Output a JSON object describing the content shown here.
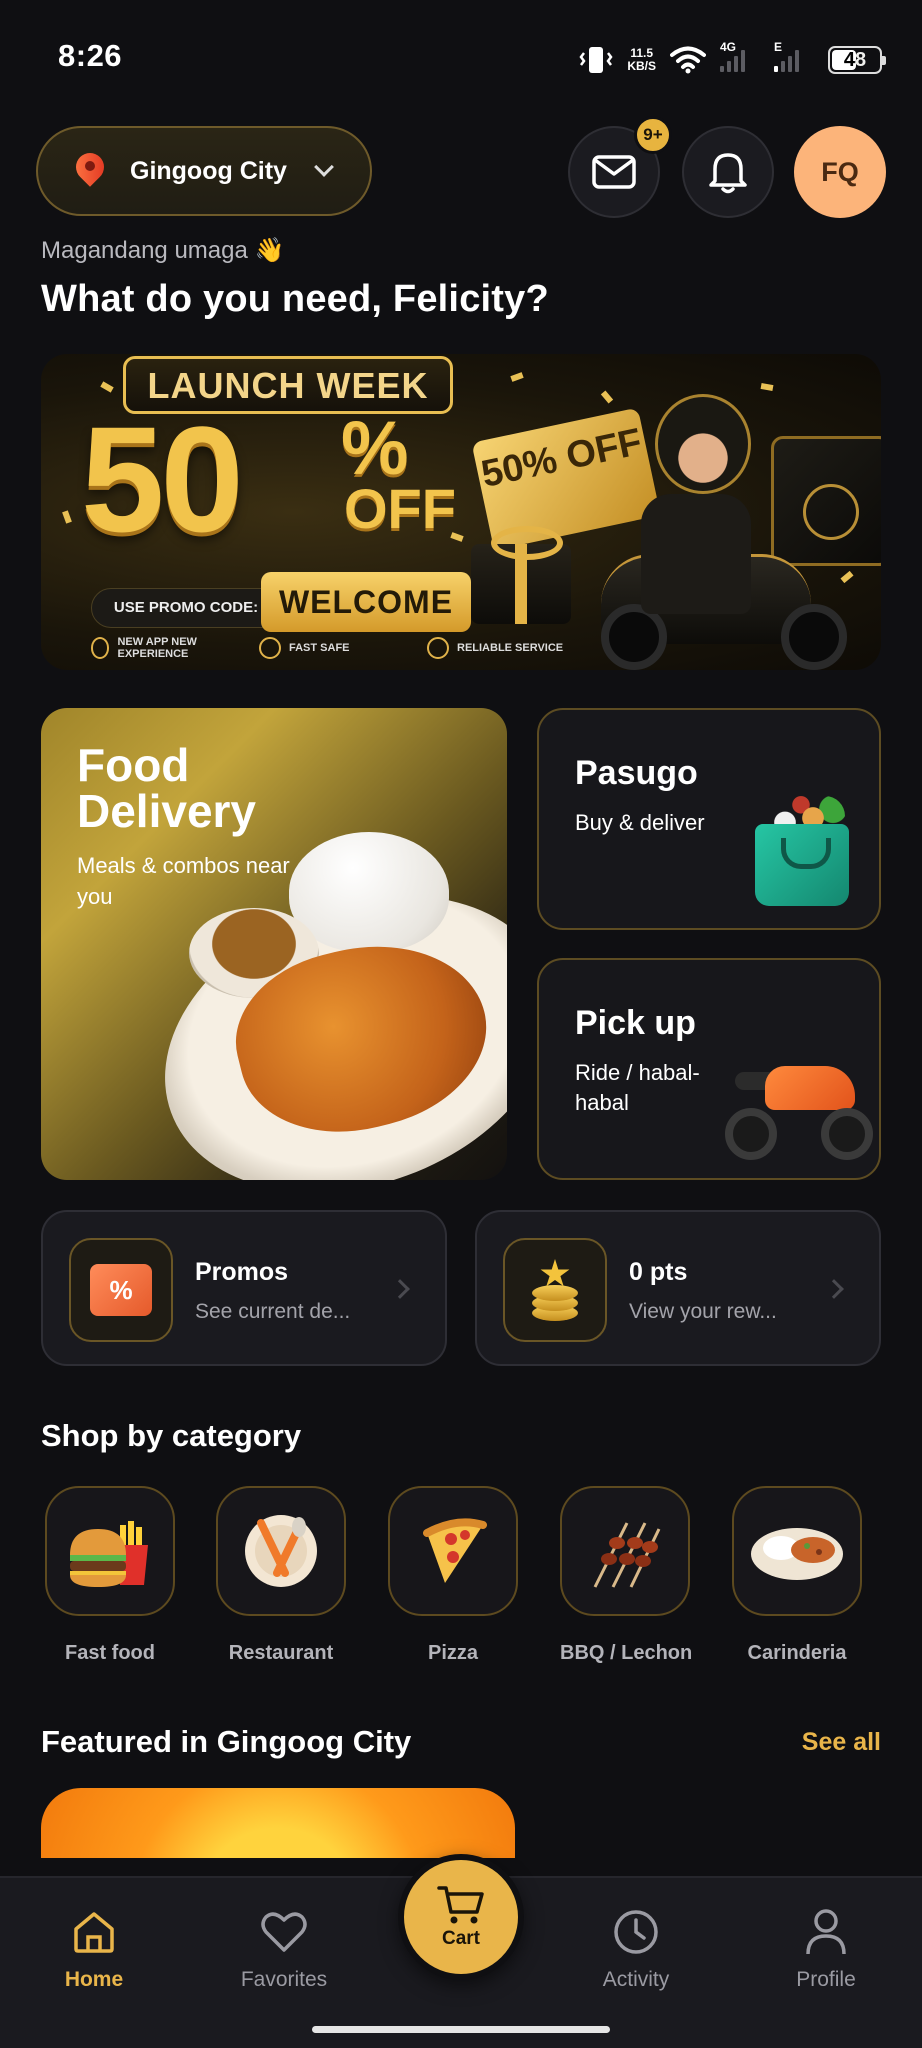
{
  "status_bar": {
    "time": "8:26",
    "net_speed_value": "11.5",
    "net_speed_unit": "KB/S",
    "network_type_1": "4G",
    "network_type_2": "E",
    "battery": "48"
  },
  "header": {
    "location": "Gingoog City",
    "message_badge": "9+",
    "avatar_initials": "FQ",
    "greeting": "Magandang umaga 👋",
    "headline": "What do you need, Felicity?"
  },
  "banner": {
    "tag": "LAUNCH WEEK",
    "discount_number": "50",
    "discount_symbol": "%",
    "discount_word": "OFF",
    "ticket_text": "50% OFF",
    "promo_label": "USE PROMO CODE:",
    "promo_code": "WELCOME",
    "features": [
      "NEW APP NEW EXPERIENCE",
      "FAST SAFE",
      "RELIABLE SERVICE"
    ]
  },
  "services": {
    "food": {
      "title": "Food Delivery",
      "subtitle": "Meals & combos near you"
    },
    "pasugo": {
      "title": "Pasugo",
      "subtitle": "Buy & deliver"
    },
    "pickup": {
      "title": "Pick up",
      "subtitle": "Ride / habal-habal"
    }
  },
  "quick_cards": {
    "promos": {
      "title": "Promos",
      "subtitle": "See current de..."
    },
    "points": {
      "title": "0 pts",
      "subtitle": "View your rew..."
    }
  },
  "categories": {
    "title": "Shop by category",
    "items": [
      {
        "label": "Fast food",
        "icon": "burger-fries-icon"
      },
      {
        "label": "Restaurant",
        "icon": "plate-utensils-icon"
      },
      {
        "label": "Pizza",
        "icon": "pizza-icon"
      },
      {
        "label": "BBQ / Lechon",
        "icon": "skewer-icon"
      },
      {
        "label": "Carinderia",
        "icon": "rice-plate-icon"
      }
    ]
  },
  "featured": {
    "title": "Featured in Gingoog City",
    "see_all": "See all"
  },
  "bottom_nav": {
    "home": "Home",
    "favorites": "Favorites",
    "cart": "Cart",
    "activity": "Activity",
    "profile": "Profile"
  },
  "colors": {
    "accent": "#e9b54a",
    "background": "#0f0f12",
    "card": "#1a1a1f",
    "avatar": "#fcb47a"
  }
}
